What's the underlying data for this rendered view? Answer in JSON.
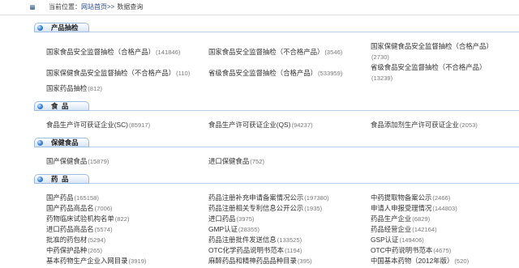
{
  "breadcrumb": {
    "prefix": "当前位置：",
    "home_link": "网站首页>>",
    "current": "数据查询"
  },
  "icons": {
    "breadcrumb": "location-icon",
    "section_bullet": "bullet-icon"
  },
  "colors": {
    "accent": "#3f86dc",
    "header_border": "#9dbce2",
    "item_text": "#333333",
    "count_text": "#7a7a7a",
    "link_blue": "#2a4d9b"
  },
  "sections": [
    {
      "title": "产品抽检",
      "items": [
        {
          "label": "国家食品安全监督抽检（合格产品）",
          "count": "(141846)"
        },
        {
          "label": "国家食品安全监督抽检（不合格产品）",
          "count": "(3546)"
        },
        {
          "label": "国家保健食品安全监督抽检（合格产品）",
          "count": "(2730)"
        },
        {
          "label": "国家保健食品安全监督抽检（不合格产品）",
          "count": "(110)"
        },
        {
          "label": "省级食品安全监督抽检（合格产品）",
          "count": "(533959)"
        },
        {
          "label": "省级食品安全监督抽检（不合格产品）",
          "count": "(13239)"
        },
        {
          "label": "国家药品抽检",
          "count": "(812)"
        }
      ]
    },
    {
      "title": "食  品",
      "items": [
        {
          "label": "食品生产许可获证企业(SC)",
          "count": "(85917)"
        },
        {
          "label": "食品生产许可获证企业(QS)",
          "count": "(94237)"
        },
        {
          "label": "食品添加剂生产许可获证企业",
          "count": "(2053)"
        }
      ]
    },
    {
      "title": "保健食品",
      "items": [
        {
          "label": "国产保健食品",
          "count": "(15879)"
        },
        {
          "label": "进口保健食品",
          "count": "(752)"
        }
      ]
    },
    {
      "title": "药  品",
      "items": [
        {
          "label": "国产药品",
          "count": "(165158)"
        },
        {
          "label": "药品注册补充申请备案情况公示",
          "count": "(197380)"
        },
        {
          "label": "中药提取物备案公示",
          "count": "(2466)"
        },
        {
          "label": "国产药品商品名",
          "count": "(7006)"
        },
        {
          "label": "药品注册相关专利信息公开公示",
          "count": "(1935)"
        },
        {
          "label": "申请人申报受理情况",
          "count": "(144803)"
        },
        {
          "label": "药物临床试验机构名单",
          "count": "(822)"
        },
        {
          "label": "进口药品",
          "count": "(3975)"
        },
        {
          "label": "药品生产企业",
          "count": "(6829)"
        },
        {
          "label": "进口药品商品名",
          "count": "(5574)"
        },
        {
          "label": "GMP认证",
          "count": "(28355)"
        },
        {
          "label": "药品经营企业",
          "count": "(142164)"
        },
        {
          "label": "批准的药包材",
          "count": "(5294)"
        },
        {
          "label": "药品注册批件发送信息",
          "count": "(133525)"
        },
        {
          "label": "GSP认证",
          "count": "(149406)"
        },
        {
          "label": "中药保护品种",
          "count": "(265)"
        },
        {
          "label": "OTC化学药品说明书范本",
          "count": "(1194)"
        },
        {
          "label": "OTC中药说明书范本",
          "count": "(4675)"
        },
        {
          "label": "基本药物生产企业入网目录",
          "count": "(3919)"
        },
        {
          "label": "麻醉药品和精神药品品种目录",
          "count": "(395)"
        },
        {
          "label": "中国基本药物（2012年版）",
          "count": "(520)"
        }
      ]
    }
  ]
}
